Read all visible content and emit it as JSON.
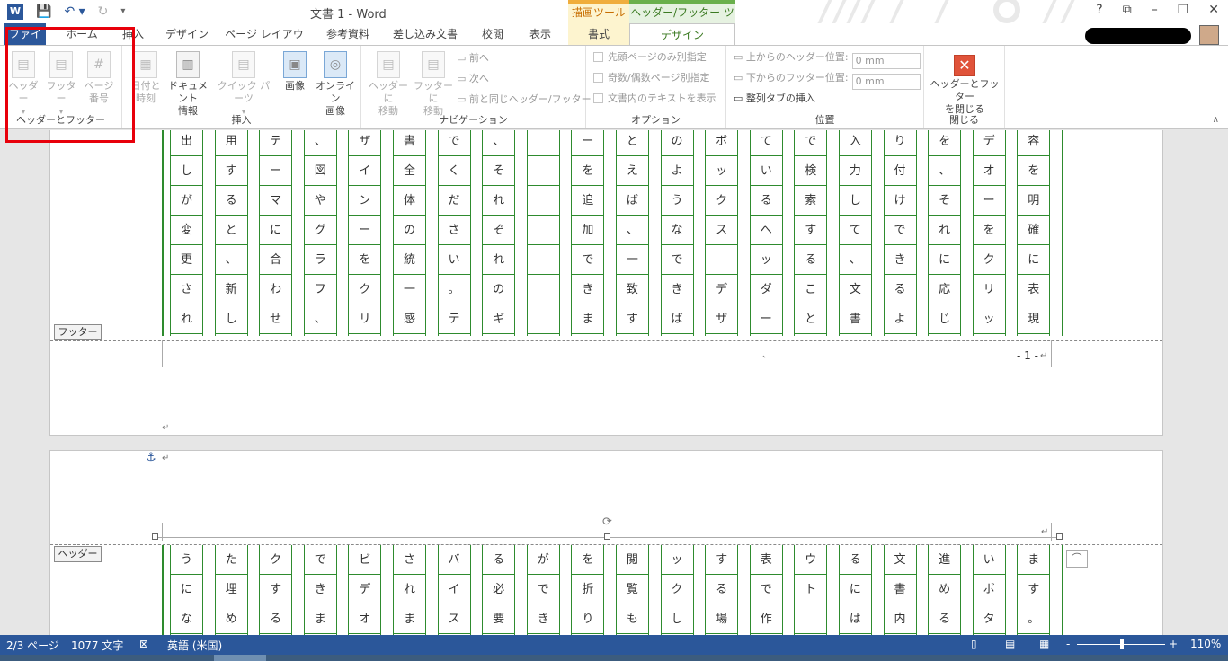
{
  "window": {
    "title": "文書 1 - Word",
    "contextual": [
      "描画ツール",
      "ヘッダー/フッター ツール"
    ],
    "controls": [
      "?",
      "⧉",
      "–",
      "❐",
      "✕"
    ]
  },
  "qat": {
    "logo": "W",
    "save": "💾",
    "undo": "↶ ▾",
    "redo": "↻",
    "more": "▾"
  },
  "tabs": [
    "ファイル",
    "ホーム",
    "挿入",
    "デザイン",
    "ページ レイアウト",
    "参考資料",
    "差し込み文書",
    "校閲",
    "表示",
    "書式",
    "デザイン"
  ],
  "ribbon": {
    "hf_group": {
      "label": "ヘッダーとフッター",
      "header": "ヘッダー",
      "footer": "フッター",
      "page_no": [
        "ページ",
        "番号"
      ]
    },
    "insert_group": {
      "label": "挿入",
      "datetime": [
        "日付と",
        "時刻"
      ],
      "docinfo": [
        "ドキュメント",
        "情報"
      ],
      "quickparts": "クイック パーツ",
      "picture": "画像",
      "online": [
        "オンライン",
        "画像"
      ]
    },
    "nav_group": {
      "label": "ナビゲーション",
      "to_header": [
        "ヘッダーに",
        "移動"
      ],
      "to_footer": [
        "フッターに",
        "移動"
      ],
      "prev": "前へ",
      "next": "次へ",
      "link_prev": "前と同じヘッダー/フッター"
    },
    "options_group": {
      "label": "オプション",
      "first_page": "先頭ページのみ別指定",
      "odd_even": "奇数/偶数ページ別指定",
      "show_text": "文書内のテキストを表示"
    },
    "position_group": {
      "label": "位置",
      "header_pos": "上からのヘッダー位置:",
      "header_val": "0 mm",
      "footer_pos": "下からのフッター位置:",
      "footer_val": "0 mm",
      "align_tab": "整列タブの挿入"
    },
    "close_group": {
      "label": "閉じる",
      "close": [
        "ヘッダーとフッター",
        "を閉じる"
      ]
    }
  },
  "document": {
    "footer_label": "フッター",
    "header_label": "ヘッダー",
    "page_number": "- 1 -",
    "page1_columns": [
      [
        "出",
        "し",
        "が",
        "変",
        "更",
        "さ",
        "れ"
      ],
      [
        "用",
        "す",
        "る",
        "と",
        "、",
        "新",
        "し"
      ],
      [
        "テ",
        "ー",
        "マ",
        "に",
        "合",
        "わ",
        "せ"
      ],
      [
        "、",
        "図",
        "や",
        "グ",
        "ラ",
        "フ",
        "、"
      ],
      [
        "ザ",
        "イ",
        "ン",
        "ー",
        "を",
        "ク",
        "リ"
      ],
      [
        "書",
        "全",
        "体",
        "の",
        "統",
        "一",
        "感"
      ],
      [
        "で",
        "く",
        "だ",
        "さ",
        "い",
        "。",
        "テ"
      ],
      [
        "、",
        "そ",
        "れ",
        "ぞ",
        "れ",
        "の",
        "ギ"
      ],
      [
        "",
        "",
        "",
        "",
        "",
        "",
        ""
      ],
      [
        "ー",
        "を",
        "追",
        "加",
        "で",
        "き",
        "ま"
      ],
      [
        "と",
        "え",
        "ば",
        "、",
        "一",
        "致",
        "す"
      ],
      [
        "の",
        "よ",
        "う",
        "な",
        "で",
        "き",
        "ば"
      ],
      [
        "ボ",
        "ッ",
        "ク",
        "ス",
        "",
        "デ",
        "ザ"
      ],
      [
        "て",
        "い",
        "る",
        "へ",
        "ッ",
        "ダ",
        "ー"
      ],
      [
        "で",
        "検",
        "索",
        "す",
        "る",
        "こ",
        "と"
      ],
      [
        "入",
        "力",
        "し",
        "て",
        "、",
        "文",
        "書"
      ],
      [
        "り",
        "付",
        "け",
        "で",
        "き",
        "る",
        "よ"
      ],
      [
        "を",
        "、",
        "そ",
        "れ",
        "に",
        "応",
        "じ"
      ],
      [
        "デ",
        "オ",
        "ー",
        "を",
        "ク",
        "リ",
        "ッ"
      ],
      [
        "容",
        "を",
        "明",
        "確",
        "に",
        "表",
        "現"
      ]
    ],
    "page2_columns": [
      [
        "う",
        "に",
        "な"
      ],
      [
        "た",
        "埋",
        "め"
      ],
      [
        "ク",
        "す",
        "る"
      ],
      [
        "で",
        "き",
        "ま"
      ],
      [
        "ビ",
        "デ",
        "オ"
      ],
      [
        "さ",
        "れ",
        "ま"
      ],
      [
        "バ",
        "イ",
        "ス"
      ],
      [
        "る",
        "必",
        "要"
      ],
      [
        "が",
        "で",
        "き"
      ],
      [
        "を",
        "折",
        "り"
      ],
      [
        "閲",
        "覧",
        "も"
      ],
      [
        "ッ",
        "ク",
        "し"
      ],
      [
        "す",
        "る",
        "場"
      ],
      [
        "表",
        "で",
        "作"
      ],
      [
        "ウ",
        "ト",
        ""
      ],
      [
        "る",
        "に",
        "は"
      ],
      [
        "文",
        "書",
        "内"
      ],
      [
        "進",
        "め",
        "る"
      ],
      [
        "い",
        "ボ",
        "タ"
      ],
      [
        "ま",
        "す",
        "。"
      ]
    ]
  },
  "status": {
    "pages": "2/3 ページ",
    "words": "1077 文字",
    "lang": "英語 (米国)",
    "zoom": "110%",
    "zoom_minus": "-",
    "zoom_plus": "+"
  }
}
